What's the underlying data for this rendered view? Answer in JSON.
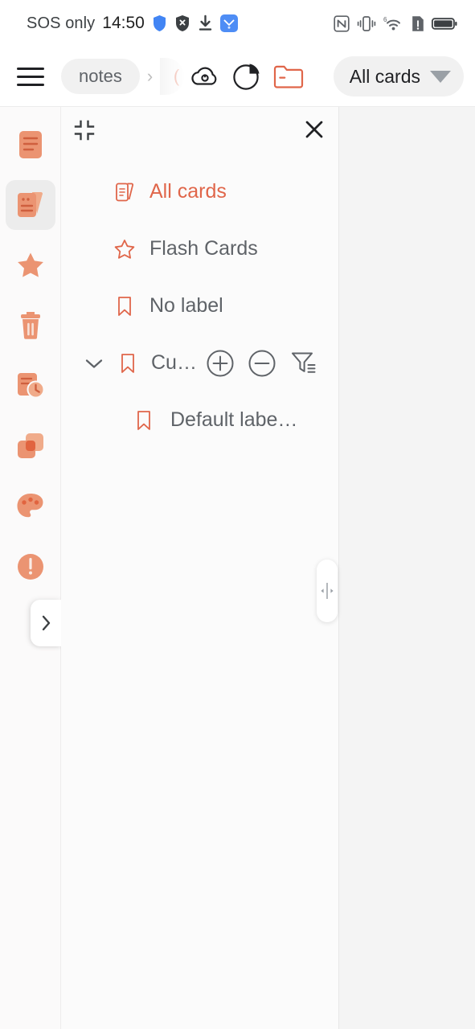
{
  "statusbar": {
    "carrier": "SOS only",
    "time": "14:50",
    "left_icons": [
      "shield-blue-icon",
      "shield-x-icon",
      "download-icon",
      "app-blue-icon"
    ],
    "right_icons": [
      "nfc-icon",
      "vibrate-icon",
      "wifi-6-icon",
      "sim-alert-icon",
      "battery-icon"
    ],
    "wifi_generation": "6"
  },
  "toolbar": {
    "menu_icon": "hamburger-icon",
    "breadcrumb": {
      "label": "notes",
      "separator": "›",
      "clipped_label": "("
    },
    "icons": [
      "cloud-sync-icon",
      "pie-chart-icon",
      "folder-icon"
    ],
    "filter_button": {
      "label": "All cards",
      "caret": "caret-down-icon"
    }
  },
  "sidebar": {
    "items": [
      {
        "name": "notes",
        "icon": "note-list-icon",
        "selected": false
      },
      {
        "name": "cards",
        "icon": "cards-stack-icon",
        "selected": true
      },
      {
        "name": "favorites",
        "icon": "star-icon",
        "selected": false
      },
      {
        "name": "trash",
        "icon": "trash-icon",
        "selected": false
      },
      {
        "name": "reminders",
        "icon": "note-clock-icon",
        "selected": false
      },
      {
        "name": "templates",
        "icon": "layers-icon",
        "selected": false
      },
      {
        "name": "themes",
        "icon": "palette-icon",
        "selected": false
      },
      {
        "name": "about",
        "icon": "alert-circle-icon",
        "selected": false
      }
    ],
    "expand_button": {
      "icon": "chevron-right-icon"
    }
  },
  "panel": {
    "collapse_icon": "collapse-corners-icon",
    "close_icon": "close-icon",
    "menu": [
      {
        "label": "All cards",
        "icon": "cards-icon",
        "active": true,
        "type": "item"
      },
      {
        "label": "Flash Cards",
        "icon": "star-outline-icon",
        "active": false,
        "type": "item"
      },
      {
        "label": "No label",
        "icon": "bookmark-icon",
        "active": false,
        "type": "item"
      },
      {
        "label": "Cu…",
        "icon": "bookmark-icon",
        "active": false,
        "type": "group",
        "chevron": "chevron-down-icon",
        "actions": [
          "plus-circle-icon",
          "minus-circle-icon",
          "filter-list-icon"
        ]
      },
      {
        "label": "Default labe…",
        "icon": "bookmark-icon",
        "active": false,
        "type": "child"
      }
    ]
  },
  "resizer": {
    "icon": "resize-handle-icon"
  },
  "colors": {
    "accent": "#e0664a",
    "text_primary": "#202124",
    "text_secondary": "#5f6368",
    "panel_bg": "#fbfbfb",
    "content_bg": "#f4f4f4",
    "selected_bg": "#ececec"
  }
}
